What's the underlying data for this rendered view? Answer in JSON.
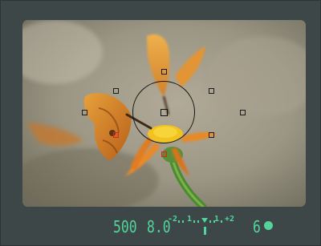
{
  "exposure": {
    "shutter_speed": "500",
    "aperture": "8.0",
    "meter_scale": {
      "minus2": "-2",
      "minus1": "1",
      "plus1": "1",
      "plus2": "+2"
    },
    "meter_level": 0
  },
  "shots_remaining": "6",
  "colors": {
    "lcd": "#52d49b",
    "body": "#3d4748",
    "active_af": "#d8261d"
  },
  "icons": {
    "focus_confirm": "filled-circle-icon"
  }
}
